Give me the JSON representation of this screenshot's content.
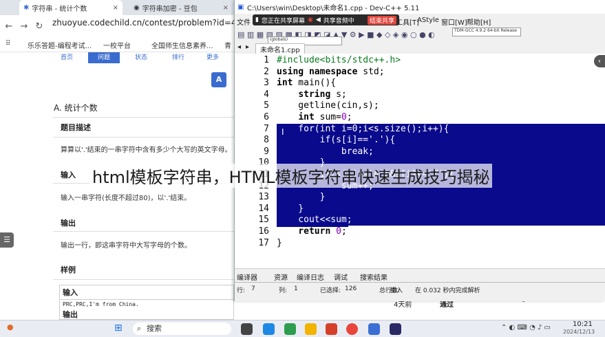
{
  "browser": {
    "tabs": [
      {
        "label": "字符串 - 统计个数",
        "close": "×"
      },
      {
        "label": "字符串加密 - 豆包",
        "close": "×"
      }
    ],
    "url": "zhuoyue.codechild.cn/contest/problem?id=48518&",
    "bookmarks": [
      "乐乐答题-编程考试...",
      "一校平台",
      "全国师生信息素养...",
      "青"
    ]
  },
  "problem": {
    "subnav": [
      "首页",
      "问题",
      "状态",
      "排行",
      "更多"
    ],
    "button_a": "A",
    "title": "A. 统计个数",
    "sections": [
      {
        "title": "题目描述",
        "text": "算算以'.'结束的一串字符中含有多少个大写的英文字母。"
      },
      {
        "title": "输入",
        "text": "输入一串字符(长度不超过80)，以'.'结束。"
      },
      {
        "title": "输出",
        "text": "输出一行，即这串字符中大写字母的个数。"
      },
      {
        "title": "样例",
        "text": ""
      }
    ],
    "sample_input_title": "输入",
    "sample_input": "PRC,PRC,I'm from China.",
    "sample_output_title": "输出"
  },
  "devcpp": {
    "title": "C:\\Users\\win\\Desktop\\未命名1.cpp - Dev-C++ 5.11",
    "menu": [
      "文件",
      "编辑",
      "搜索",
      "视图",
      "项目",
      "运行",
      "工具[T]",
      "AStyle",
      "窗口[W]",
      "帮助[H]"
    ],
    "share_bar": {
      "sharing": "您正在共享屏幕",
      "audio": "共享音频中",
      "stop": "结束共享"
    },
    "toolbar_combo1": "(globals)",
    "toolbar_combo2": "TDM-GCC 4.9.2 64-bit Release",
    "file_tab": "未命名1.cpp",
    "line_numbers": [
      "1",
      "2",
      "3",
      "4",
      "5",
      "6",
      "7",
      "8",
      "9",
      "10",
      "11",
      "12",
      "13",
      "14",
      "15",
      "16",
      "17"
    ],
    "code_lines": [
      "#include<bits/stdc++.h>",
      "using namespace std;",
      "int main(){",
      "    string s;",
      "    getline(cin,s);",
      "    int sum=0;",
      "    for(int i=0;i<s.size();i++){",
      "        if(s[i]=='.'){",
      "            break;",
      "        }",
      "        if(s[i]>='A'&&s[i]<='Z'){",
      "            sum++;",
      "        }",
      "    }",
      "    cout<<sum;",
      "    return 0;",
      "}"
    ],
    "bottom_tabs": [
      "编译器",
      "资源",
      "编译日志",
      "调试",
      "搜索结果"
    ],
    "status": {
      "row_label": "行:",
      "row": "7",
      "col_label": "列:",
      "col": "1",
      "sel_label": "已选择:",
      "sel": "126",
      "total_label": "总行数:",
      "ins": "插入",
      "parse": "在 0.032 秒内完成解析"
    }
  },
  "side_panel": {
    "days": "4天前",
    "status": "通过",
    "more": "通过"
  },
  "overlay_caption": "html模板字符串，HTML模板字符串快速生成技巧揭秘",
  "taskbar": {
    "search": "搜索",
    "time": "10:21",
    "date": "2024/12/13"
  },
  "colors": {
    "selection": "#0a0a8c",
    "accent": "#3a6cd0",
    "stop": "#e0433a"
  }
}
